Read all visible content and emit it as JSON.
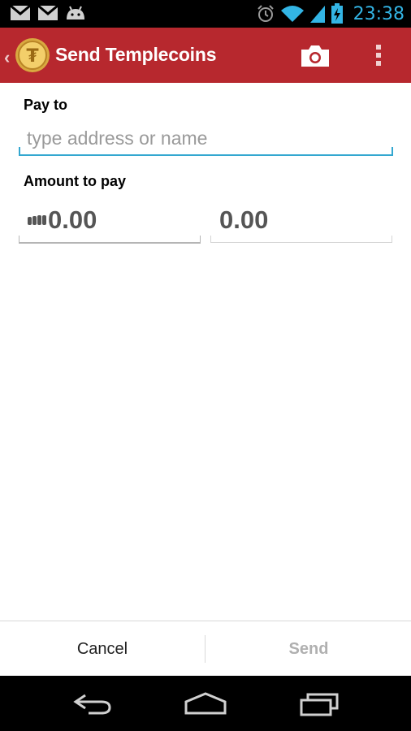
{
  "status_bar": {
    "time": "23:38",
    "left_icons": [
      "gmail-icon",
      "gmail-icon",
      "android-icon"
    ],
    "right_icons": [
      "alarm-icon",
      "wifi-icon",
      "signal-icon",
      "battery-charging-icon"
    ]
  },
  "action_bar": {
    "title": "Send Templecoins",
    "actions": [
      "camera-icon",
      "overflow-menu-icon"
    ],
    "color": "#b7282e"
  },
  "form": {
    "pay_to_label": "Pay to",
    "address_placeholder": "type address or name",
    "amount_label": "Amount to pay",
    "amount_btc": "0.00",
    "amount_local": "0.00"
  },
  "buttons": {
    "cancel": "Cancel",
    "send": "Send"
  },
  "nav": [
    "back-icon",
    "home-icon",
    "recents-icon"
  ],
  "colors": {
    "accent": "#33b5e5",
    "action_bar": "#b7282e"
  }
}
